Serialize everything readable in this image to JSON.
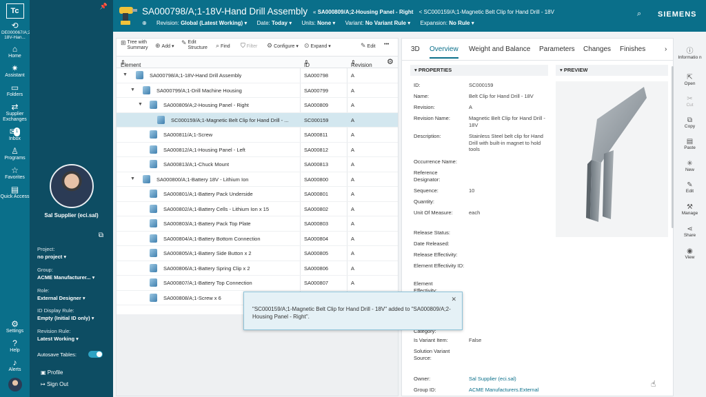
{
  "app": {
    "logo": "Tc"
  },
  "rail": {
    "context_label": "DE000067/A;2-18V-Han...",
    "items": [
      {
        "icon": "home-icon",
        "label": "Home"
      },
      {
        "icon": "assistant-icon",
        "label": "Assistant"
      },
      {
        "icon": "folders-icon",
        "label": "Folders"
      },
      {
        "icon": "supplier-exchanges-icon",
        "label": "Supplier Exchanges"
      },
      {
        "icon": "inbox-icon",
        "label": "Inbox",
        "badge": "1"
      },
      {
        "icon": "programs-icon",
        "label": "Programs"
      },
      {
        "icon": "favorites-icon",
        "label": "Favorites"
      },
      {
        "icon": "quick-access-icon",
        "label": "Quick Access"
      }
    ],
    "bottom": [
      {
        "icon": "settings-icon",
        "label": "Settings"
      },
      {
        "icon": "help-icon",
        "label": "Help"
      },
      {
        "icon": "alerts-icon",
        "label": "Alerts"
      }
    ]
  },
  "panel": {
    "user_name": "Sal Supplier (eci.sal)",
    "project_label": "Project:",
    "project_value": "no project",
    "group_label": "Group:",
    "group_value": "ACME Manufacturer...",
    "role_label": "Role:",
    "role_value": "External Designer",
    "id_rule_label": "ID Display Rule:",
    "id_rule_value": "Empty (Initial ID only)",
    "revision_rule_label": "Revision Rule:",
    "revision_rule_value": "Latest Working",
    "autosave_label": "Autosave Tables:",
    "profile_label": "Profile",
    "signout_label": "Sign Out"
  },
  "header": {
    "title": "SA000798/A;1-18V-Hand Drill Assembly",
    "crumb_sep": "«",
    "crumb_1": "SA000809/A;2-Housing Panel - Right",
    "crumb_sep2": "<",
    "crumb_2": "SC000159/A;1-Magnetic Belt Clip for Hand Drill - 18V",
    "filters": [
      {
        "key": "Revision:",
        "value": "Global (Latest Working)"
      },
      {
        "key": "Date:",
        "value": "Today"
      },
      {
        "key": "Units:",
        "value": "None"
      },
      {
        "key": "Variant:",
        "value": "No Variant Rule"
      },
      {
        "key": "Expansion:",
        "value": "No Rule"
      }
    ],
    "brand": "SIEMENS"
  },
  "toolbar": {
    "tree_summary": "Tree with Summary",
    "add": "Add",
    "edit_structure": "Edit Structure",
    "find": "Find",
    "filter": "Filter",
    "configure": "Configure",
    "expand": "Expand",
    "edit": "Edit",
    "more": "•••"
  },
  "table": {
    "headers": {
      "element": "Element",
      "id": "ID",
      "revision": "Revision"
    },
    "rows": [
      {
        "name": "SA000798/A;1-18V-Hand Drill Assembly",
        "id": "SA000798",
        "rev": "A"
      },
      {
        "name": "SA000799/A;1-Drill Machine Housing",
        "id": "SA000799",
        "rev": "A"
      },
      {
        "name": "SA000809/A;2-Housing Panel - Right",
        "id": "SA000809",
        "rev": "A"
      },
      {
        "name": "SC000159/A;1-Magnetic Belt Clip for Hand Drill - ...",
        "id": "SC000159",
        "rev": "A"
      },
      {
        "name": "SA000811/A;1-Screw",
        "id": "SA000811",
        "rev": "A"
      },
      {
        "name": "SA000812/A;1-Housing Panel - Left",
        "id": "SA000812",
        "rev": "A"
      },
      {
        "name": "SA000813/A;1-Chuck Mount",
        "id": "SA000813",
        "rev": "A"
      },
      {
        "name": "SA000800/A;1-Battery 18V - Lithium Ion",
        "id": "SA000800",
        "rev": "A"
      },
      {
        "name": "SA000801/A;1-Battery Pack Underside",
        "id": "SA000801",
        "rev": "A"
      },
      {
        "name": "SA000802/A;1-Battery Cells - Lithium Ion x 15",
        "id": "SA000802",
        "rev": "A"
      },
      {
        "name": "SA000803/A;1-Battery Pack Top Plate",
        "id": "SA000803",
        "rev": "A"
      },
      {
        "name": "SA000804/A;1-Battery Bottom Connection",
        "id": "SA000804",
        "rev": "A"
      },
      {
        "name": "SA000805/A;1-Battery Side Button x 2",
        "id": "SA000805",
        "rev": "A"
      },
      {
        "name": "SA000806/A;1-Battery Spring Clip x 2",
        "id": "SA000806",
        "rev": "A"
      },
      {
        "name": "SA000807/A;1-Battery Top Connection",
        "id": "SA000807",
        "rev": "A"
      },
      {
        "name": "SA000808/A;1-Screw x 6",
        "id": "SA000808",
        "rev": "A"
      }
    ]
  },
  "toast": {
    "message": "\"SC000159/A;1-Magnetic Belt Clip for Hand Drill - 18V\" added to \"SA000809/A;2-Housing Panel - Right\"."
  },
  "details": {
    "tabs": [
      "3D",
      "Overview",
      "Weight and Balance",
      "Parameters",
      "Changes",
      "Finishes"
    ],
    "properties_title": "PROPERTIES",
    "preview_title": "PREVIEW",
    "props": [
      {
        "k": "ID:",
        "v": "SC000159"
      },
      {
        "k": "Name:",
        "v": "Belt Clip for Hand Drill - 18V"
      },
      {
        "k": "Revision:",
        "v": "A"
      },
      {
        "k": "Revision Name:",
        "v": "Magnetic Belt Clip for Hand Drill - 18V"
      },
      {
        "k": "Description:",
        "v": "Stainless Steel belt clip for Hand Drill with built-in magnet to hold tools"
      },
      {
        "k": "Occurrence Name:",
        "v": ""
      },
      {
        "k": "Reference Designator:",
        "v": ""
      },
      {
        "k": "Sequence:",
        "v": "10"
      },
      {
        "k": "Quantity:",
        "v": ""
      },
      {
        "k": "Unit Of Measure:",
        "v": "each"
      },
      {
        "k": "Release Status:",
        "v": ""
      },
      {
        "k": "Date Released:",
        "v": ""
      },
      {
        "k": "Release Effectivity:",
        "v": ""
      },
      {
        "k": "Element Effectivity ID:",
        "v": ""
      },
      {
        "k": "Element Effectivity:",
        "v": ""
      },
      {
        "k": "Category:",
        "v": ""
      },
      {
        "k": "Is Variant Item:",
        "v": "False"
      },
      {
        "k": "Solution Variant Source:",
        "v": ""
      },
      {
        "k": "Owner:",
        "v": "Sal Supplier (eci.sal)"
      },
      {
        "k": "Group ID:",
        "v": "ACME Manufacturers.External"
      }
    ]
  },
  "commands": [
    {
      "icon": "information-icon",
      "label": "Informatio n"
    },
    {
      "icon": "open-icon",
      "label": "Open"
    },
    {
      "icon": "cut-icon",
      "label": "Cut"
    },
    {
      "icon": "copy-icon",
      "label": "Copy"
    },
    {
      "icon": "paste-icon",
      "label": "Paste"
    },
    {
      "icon": "new-icon",
      "label": "New"
    },
    {
      "icon": "edit-icon",
      "label": "Edit"
    },
    {
      "icon": "manage-icon",
      "label": "Manage"
    },
    {
      "icon": "share-icon",
      "label": "Share"
    },
    {
      "icon": "view-icon",
      "label": "View"
    }
  ],
  "colors": {
    "teal": "#0a6f8a",
    "dark_teal": "#0d4d63",
    "selected_row": "#d3e7ef"
  }
}
